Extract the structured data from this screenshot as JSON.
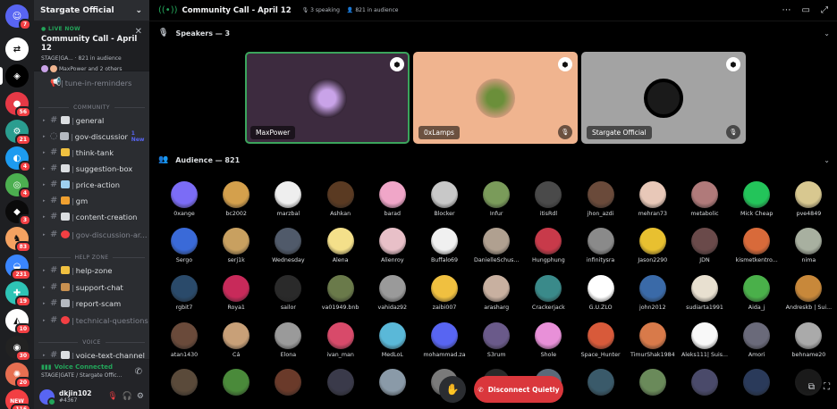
{
  "rail": {
    "servers": [
      {
        "glyph": "☺",
        "color": "#5865f2",
        "badge": "7"
      },
      {
        "glyph": "⇄",
        "color": "#ffffff",
        "badge": ""
      },
      {
        "glyph": "◈",
        "color": "#000000",
        "badge": ""
      },
      {
        "glyph": "●",
        "color": "#e63946",
        "badge": "56"
      },
      {
        "glyph": "⚙",
        "color": "#2a9d8f",
        "badge": "21"
      },
      {
        "glyph": "◐",
        "color": "#1d9bf0",
        "badge": "4"
      },
      {
        "glyph": "◎",
        "color": "#4caf50",
        "badge": "4"
      },
      {
        "glyph": "◆",
        "color": "#0a0a0a",
        "badge": "3"
      },
      {
        "glyph": "♞",
        "color": "#f4a261",
        "badge": "83"
      },
      {
        "glyph": "◒",
        "color": "#3a86ff",
        "badge": "231"
      },
      {
        "glyph": "✚",
        "color": "#2ec4b6",
        "badge": "19"
      },
      {
        "glyph": "◭",
        "color": "#ffffff",
        "badge": "10"
      },
      {
        "glyph": "◉",
        "color": "#222222",
        "badge": "30"
      },
      {
        "glyph": "✺",
        "color": "#e76f51",
        "badge": "20"
      },
      {
        "glyph": "NEW",
        "color": "#f23f43",
        "badge": "116"
      }
    ]
  },
  "server": {
    "name": "Stargate Official",
    "chevron": "⌄"
  },
  "live": {
    "status": "LIVE NOW",
    "title": "Community Call - April 12",
    "meta": "STAGE|GA... · 821 in audience",
    "people": "MaxPower and 2 others"
  },
  "channels": {
    "reminders": "tune-in-reminders",
    "cat_community": "COMMUNITY",
    "general": "general",
    "gov_discussion": "gov-discussion",
    "gov_new": "1 New",
    "think_tank": "think-tank",
    "suggestion_box": "suggestion-box",
    "price_action": "price-action",
    "gm": "gm",
    "content_creation": "content-creation",
    "gov_archive": "gov-discussion-ar...",
    "cat_help": "HELP ZONE",
    "help_zone": "help-zone",
    "support_chat": "support-chat",
    "report_scam": "report-scam",
    "technical": "technical-questions",
    "cat_voice": "VOICE",
    "voice_text": "voice-text-channel"
  },
  "voice_status": {
    "title": "Voice Connected",
    "sub": "STAGE|GATE / Stargate Offic..."
  },
  "user": {
    "name": "dkjin102",
    "tag": "#4367"
  },
  "topbar": {
    "title": "Community Call - April 12",
    "speaking": "3 speaking",
    "audience": "821 in audience"
  },
  "speakers_head": "Speakers — 3",
  "audience_head": "Audience — 821",
  "speakers": [
    {
      "name": "MaxPower",
      "bg": "#3d2b3f",
      "pfp": "#c9a3e8",
      "border": "#3ba55c"
    },
    {
      "name": "0xLamps",
      "bg": "#f0b48f",
      "pfp": "#6b8f3a",
      "border": ""
    },
    {
      "name": "Stargate Official",
      "bg": "#a3a3a3",
      "pfp": "#000000",
      "border": ""
    }
  ],
  "audience_rows": [
    [
      {
        "n": "0xange",
        "c": "#7b6cf6"
      },
      {
        "n": "bc2002",
        "c": "#d4a04c"
      },
      {
        "n": "marzbal",
        "c": "#eeeeee"
      },
      {
        "n": "Ashkan",
        "c": "#5a3a22"
      },
      {
        "n": "barad",
        "c": "#f0a6c8"
      },
      {
        "n": "Blocker",
        "c": "#c8c8c8"
      },
      {
        "n": "Infur",
        "c": "#7a9b5a"
      },
      {
        "n": "itisRdl",
        "c": "#4a4a4a"
      },
      {
        "n": "jhon_azdi",
        "c": "#6a4a3a"
      },
      {
        "n": "mehran73",
        "c": "#e8c8b8"
      },
      {
        "n": "metabolic",
        "c": "#b07a7a"
      },
      {
        "n": "Mick Cheap",
        "c": "#23c45a"
      },
      {
        "n": "pve4849",
        "c": "#d8c890"
      }
    ],
    [
      {
        "n": "Sergo",
        "c": "#3a6ad8"
      },
      {
        "n": "serj1k",
        "c": "#c8a060"
      },
      {
        "n": "Wednesday",
        "c": "#505a6a"
      },
      {
        "n": "Alena",
        "c": "#f4e08a"
      },
      {
        "n": "Alienroy",
        "c": "#e8c0c8"
      },
      {
        "n": "Buffalo69",
        "c": "#f0f0f0"
      },
      {
        "n": "DanielleSchus...",
        "c": "#b0a090"
      },
      {
        "n": "Hungphung",
        "c": "#c83a4a"
      },
      {
        "n": "infinitysra",
        "c": "#8a8a8a"
      },
      {
        "n": "Jason2290",
        "c": "#e8c030"
      },
      {
        "n": "JDN",
        "c": "#6a4a4a"
      },
      {
        "n": "kismetkentro...",
        "c": "#d86a3a"
      },
      {
        "n": "nima",
        "c": "#a8b0a0"
      }
    ],
    [
      {
        "n": "rgbit7",
        "c": "#2a4a6a"
      },
      {
        "n": "Roya1",
        "c": "#c82a5a"
      },
      {
        "n": "sailor",
        "c": "#2a2a2a"
      },
      {
        "n": "va01949.bnb",
        "c": "#6a7a4a"
      },
      {
        "n": "vahidaz92",
        "c": "#9a9a9a"
      },
      {
        "n": "zaibi007",
        "c": "#f0c040"
      },
      {
        "n": "arasharg",
        "c": "#c8b0a0"
      },
      {
        "n": "Crackerjack",
        "c": "#3a8a8a"
      },
      {
        "n": "G.U.ZLO",
        "c": "#ffffff"
      },
      {
        "n": "john2012",
        "c": "#3a6aa8"
      },
      {
        "n": "sudiarta1991",
        "c": "#e8e0d0"
      },
      {
        "n": "Aida_j",
        "c": "#4ab04a"
      },
      {
        "n": "Andreskb | Sui...",
        "c": "#c8883a"
      }
    ],
    [
      {
        "n": "atan1430",
        "c": "#6a4a3a"
      },
      {
        "n": "Cá",
        "c": "#c8a078"
      },
      {
        "n": "Elona",
        "c": "#9a9a9a"
      },
      {
        "n": "ivan_man",
        "c": "#d84a6a"
      },
      {
        "n": "MedLoL",
        "c": "#5ab8d8"
      },
      {
        "n": "mohammad.za",
        "c": "#5865f2"
      },
      {
        "n": "S3rum",
        "c": "#6a5a8a"
      },
      {
        "n": "Shole",
        "c": "#e890d8"
      },
      {
        "n": "Space_Hunter",
        "c": "#d85a3a"
      },
      {
        "n": "TimurShak1984",
        "c": "#d87a4a"
      },
      {
        "n": "Aleks111| Suis...",
        "c": "#f8f8f8"
      },
      {
        "n": "Amori",
        "c": "#6a6a7a"
      },
      {
        "n": "behname20",
        "c": "#aaaaaa"
      }
    ],
    [
      {
        "n": "",
        "c": "#5a4a3a"
      },
      {
        "n": "",
        "c": "#4a8a3a"
      },
      {
        "n": "",
        "c": "#6a3a2a"
      },
      {
        "n": "",
        "c": "#3a3a4a"
      },
      {
        "n": "",
        "c": "#8a9aa8"
      },
      {
        "n": "",
        "c": "#7a7a7a"
      },
      {
        "n": "",
        "c": "#2a2a2a"
      },
      {
        "n": "",
        "c": "#5a6a7a"
      },
      {
        "n": "",
        "c": "#3a5a6a"
      },
      {
        "n": "",
        "c": "#6a8a5a"
      },
      {
        "n": "",
        "c": "#4a4a6a"
      },
      {
        "n": "",
        "c": "#2a3a5a"
      },
      {
        "n": "",
        "c": "#1a1a1a"
      }
    ]
  ],
  "buttons": {
    "disconnect": "Disconnect Quietly"
  },
  "colors": {
    "accent": "#5865f2",
    "danger": "#da373c",
    "online": "#23a55a"
  }
}
